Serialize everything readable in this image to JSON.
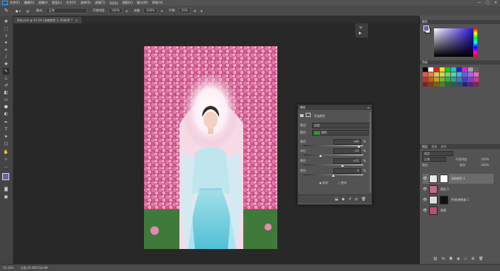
{
  "app": {
    "logo": "Ps"
  },
  "menu": [
    "文件(F)",
    "编辑(E)",
    "图像(I)",
    "图层(L)",
    "文字(Y)",
    "选择(S)",
    "滤镜(T)",
    "3D(D)",
    "视图(V)",
    "窗口(W)",
    "帮助(H)"
  ],
  "window_controls": {
    "minimize": "—",
    "maximize": "□",
    "close": "✕"
  },
  "options": {
    "mode_label": "模式:",
    "mode_value": "正常",
    "opacity_label": "不透明度:",
    "opacity_value": "100%",
    "flow_label": "流量:",
    "flow_value": "100%",
    "smooth_label": "平滑:",
    "smooth_value": "10%"
  },
  "tab": {
    "label": "荷花.psd @ 33.3% (选取颜色 1, RGB/8) *",
    "close": "×"
  },
  "status": {
    "zoom": "33.33%",
    "doc": "文档:20.6M/158.4M"
  },
  "properties": {
    "title": "属性",
    "panel_name": "可选颜色",
    "preset_label": "预设:",
    "preset_value": "自定",
    "colors_label": "颜色:",
    "colors_value": "绿色",
    "cyan_label": "青色:",
    "cyan_value": "+86",
    "cyan_level": 0.93,
    "magenta_label": "洋红:",
    "magenta_value": "-42",
    "magenta_level": 0.29,
    "yellow_label": "黄色:",
    "yellow_value": "+32",
    "yellow_level": 0.66,
    "black_label": "黑色:",
    "black_value": "0",
    "black_level": 0.5,
    "relative_label": "相对",
    "absolute_label": "绝对",
    "percent": "%"
  },
  "color_panel": {
    "title": "颜色"
  },
  "swatches_panel": {
    "title": "色板"
  },
  "layers_panel": {
    "tabs": [
      "图层",
      "通道",
      "路径"
    ],
    "kind_label": "类型",
    "blend": "正常",
    "opacity_label": "不透明度:",
    "opacity_value": "100%",
    "lock_label": "锁定:",
    "fill_label": "填充:",
    "fill_value": "100%",
    "layers": [
      {
        "name": "选取颜色 1",
        "thumb": "#e8e8e8"
      },
      {
        "name": "图层 2",
        "thumb": "#c86a8a"
      },
      {
        "name": "色相/饱和度 1",
        "thumb": "#111"
      },
      {
        "name": "背景",
        "thumb": "#b85070"
      }
    ]
  },
  "swatch_colors": [
    "#000",
    "#fff",
    "#e02020",
    "#f0e020",
    "#20c020",
    "#20c0e0",
    "#2020d0",
    "#e020e0",
    "#a0a0a0",
    "#606060",
    "#f05050",
    "#f08030",
    "#f0c050",
    "#c0e040",
    "#60e060",
    "#40e0b0",
    "#40b0f0",
    "#6060f0",
    "#b060f0",
    "#f060c0",
    "#c03030",
    "#c06020",
    "#c0a030",
    "#80b030",
    "#30b040",
    "#30a090",
    "#3080c0",
    "#4040c0",
    "#8040c0",
    "#c04090",
    "#802020",
    "#804010",
    "#806010",
    "#508020",
    "#207030",
    "#206050",
    "#205080",
    "#202080",
    "#502080",
    "#802050"
  ]
}
